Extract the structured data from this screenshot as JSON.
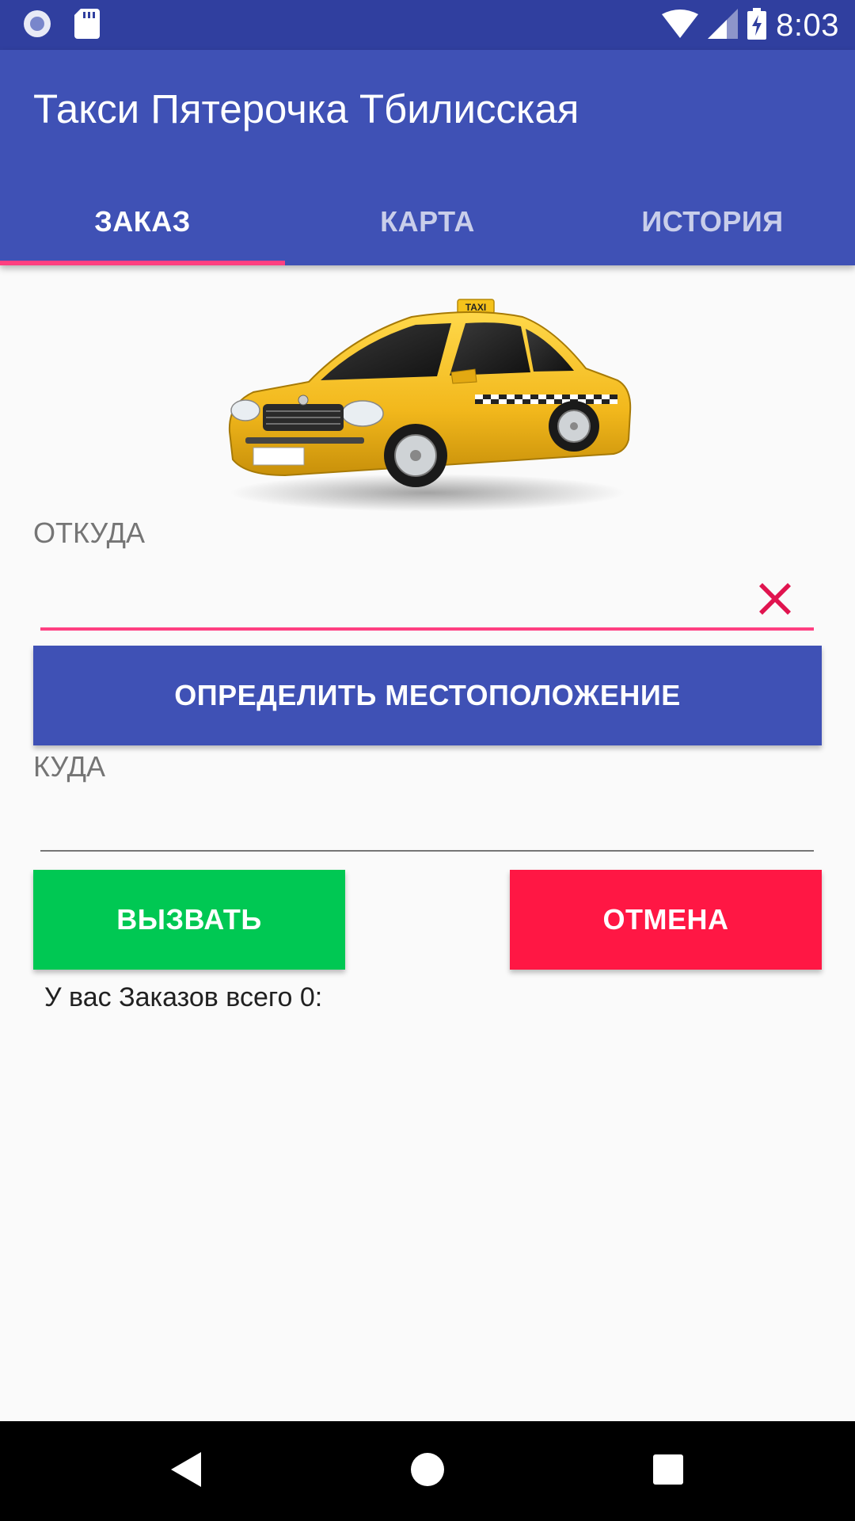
{
  "status_bar": {
    "time": "8:03",
    "icons": [
      "notification-circle-icon",
      "sd-card-icon",
      "wifi-icon",
      "cell-signal-icon",
      "battery-charging-icon"
    ],
    "background": "#303f9f"
  },
  "app_bar": {
    "title": "Такси Пятерочка Тбилисская",
    "background": "#3f51b5"
  },
  "tabs": [
    {
      "label": "ЗАКАЗ",
      "active": true
    },
    {
      "label": "КАРТА",
      "active": false
    },
    {
      "label": "ИСТОРИЯ",
      "active": false
    }
  ],
  "tab_indicator_color": "#ff4081",
  "image": {
    "name": "taxi-car-image",
    "taxi_sign": "TAXI"
  },
  "from": {
    "label": "ОТКУДА",
    "value": "",
    "clear_icon": "close-icon"
  },
  "locate_button": {
    "label": "ОПРЕДЕЛИТЬ МЕСТОПОЛОЖЕНИЕ"
  },
  "to": {
    "label": "КУДА",
    "value": ""
  },
  "call_button": {
    "label": "ВЫЗВАТЬ",
    "color": "#00c853"
  },
  "cancel_button": {
    "label": "ОТМЕНА",
    "color": "#ff1744"
  },
  "orders_text": "У вас Заказов всего 0:",
  "nav_bar": {
    "icons": [
      "back-triangle-icon",
      "home-circle-icon",
      "recents-square-icon"
    ]
  }
}
